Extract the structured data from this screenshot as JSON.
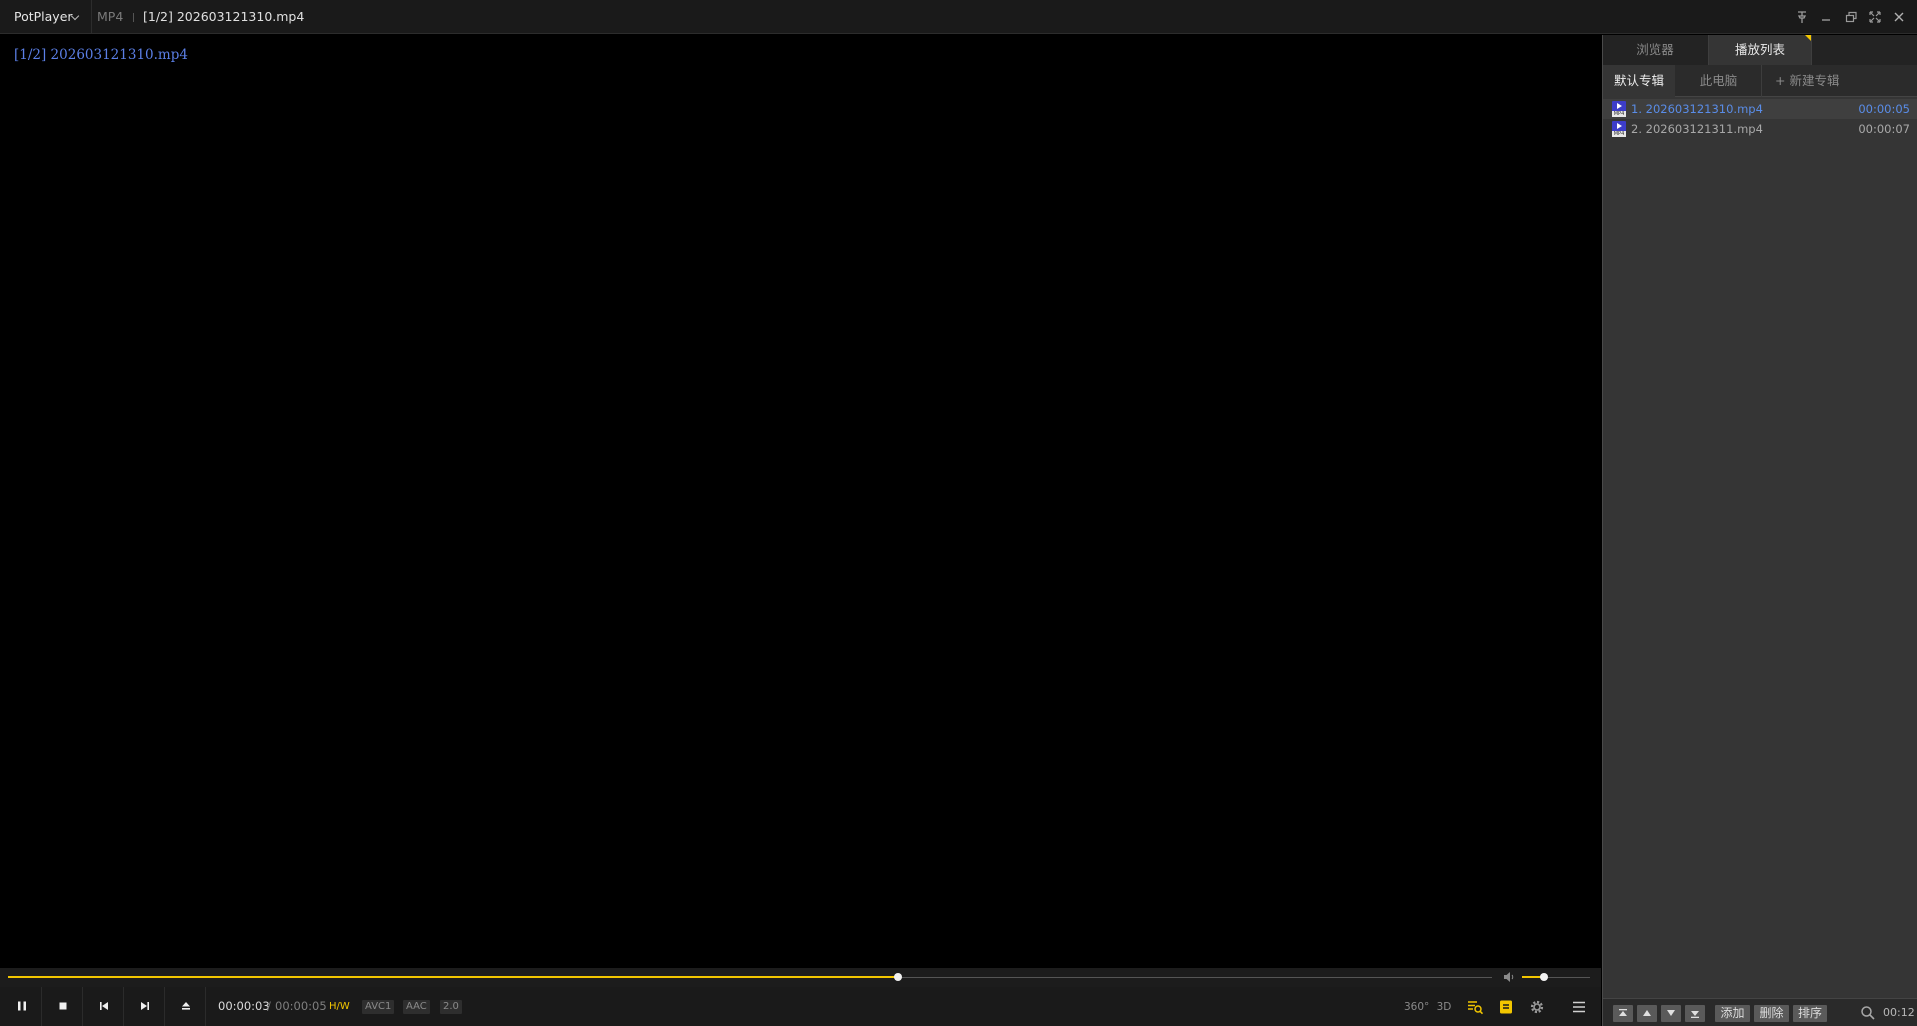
{
  "titlebar": {
    "app_name": "PotPlayer",
    "format": "MP4",
    "title": "[1/2] 202603121310.mp4",
    "icons": [
      "pin-icon",
      "minimize-icon",
      "restore-icon",
      "fullscreen-icon",
      "close-icon"
    ]
  },
  "video": {
    "osd_text": "[1/2] 202603121310.mp4"
  },
  "panel": {
    "tabs": [
      {
        "label": "浏览器",
        "active": false
      },
      {
        "label": "播放列表",
        "active": true
      }
    ],
    "album_tabs": [
      {
        "label": "默认专辑",
        "active": true
      },
      {
        "label": "此电脑",
        "active": false
      },
      {
        "label": "+ 新建专辑",
        "active": false
      }
    ],
    "playlist": [
      {
        "name": "1. 202603121310.mp4",
        "duration": "00:00:05",
        "active": true
      },
      {
        "name": "2. 202603121311.mp4",
        "duration": "00:00:07",
        "active": false
      }
    ],
    "bottom": {
      "add_label": "添加",
      "delete_label": "删除",
      "sort_label": "排序",
      "clock": "00:12"
    }
  },
  "playback": {
    "current_time": "00:00:03",
    "separator": "/",
    "total_time": "00:00:05",
    "progress": 0.6,
    "volume": 0.33,
    "hw_badge": "H/W",
    "video_codec": "AVC1",
    "audio_codec": "AAC",
    "channels": "2.0",
    "icon_360_label": "360°",
    "icon_3d_label": "3D"
  },
  "colors": {
    "accent": "#f2c600",
    "active_item": "#5a8de8",
    "osd": "#5b7fe6"
  }
}
